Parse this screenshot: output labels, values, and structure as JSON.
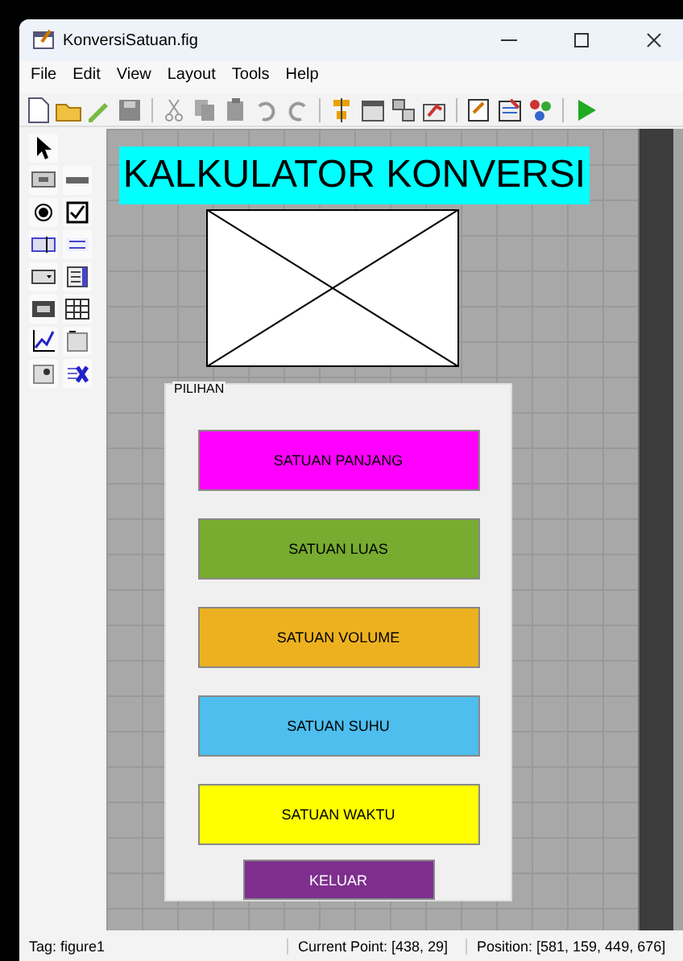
{
  "window": {
    "title": "KonversiSatuan.fig"
  },
  "menu": [
    "File",
    "Edit",
    "View",
    "Layout",
    "Tools",
    "Help"
  ],
  "figure": {
    "title_label": "KALKULATOR KONVERSI",
    "panel": {
      "title": "PILIHAN",
      "buttons": [
        {
          "label": "SATUAN PANJANG",
          "color": "#ff00ff"
        },
        {
          "label": "SATUAN LUAS",
          "color": "#77ac30"
        },
        {
          "label": "SATUAN VOLUME",
          "color": "#edb120"
        },
        {
          "label": "SATUAN SUHU",
          "color": "#4dbeee"
        },
        {
          "label": "SATUAN WAKTU",
          "color": "#ffff00"
        },
        {
          "label": "KELUAR",
          "color": "#7e2f8e"
        }
      ]
    }
  },
  "status_bar": {
    "tag": "Tag: figure1",
    "current_point": "Current Point:  [438, 29]",
    "position": "Position: [581, 159, 449, 676]"
  }
}
